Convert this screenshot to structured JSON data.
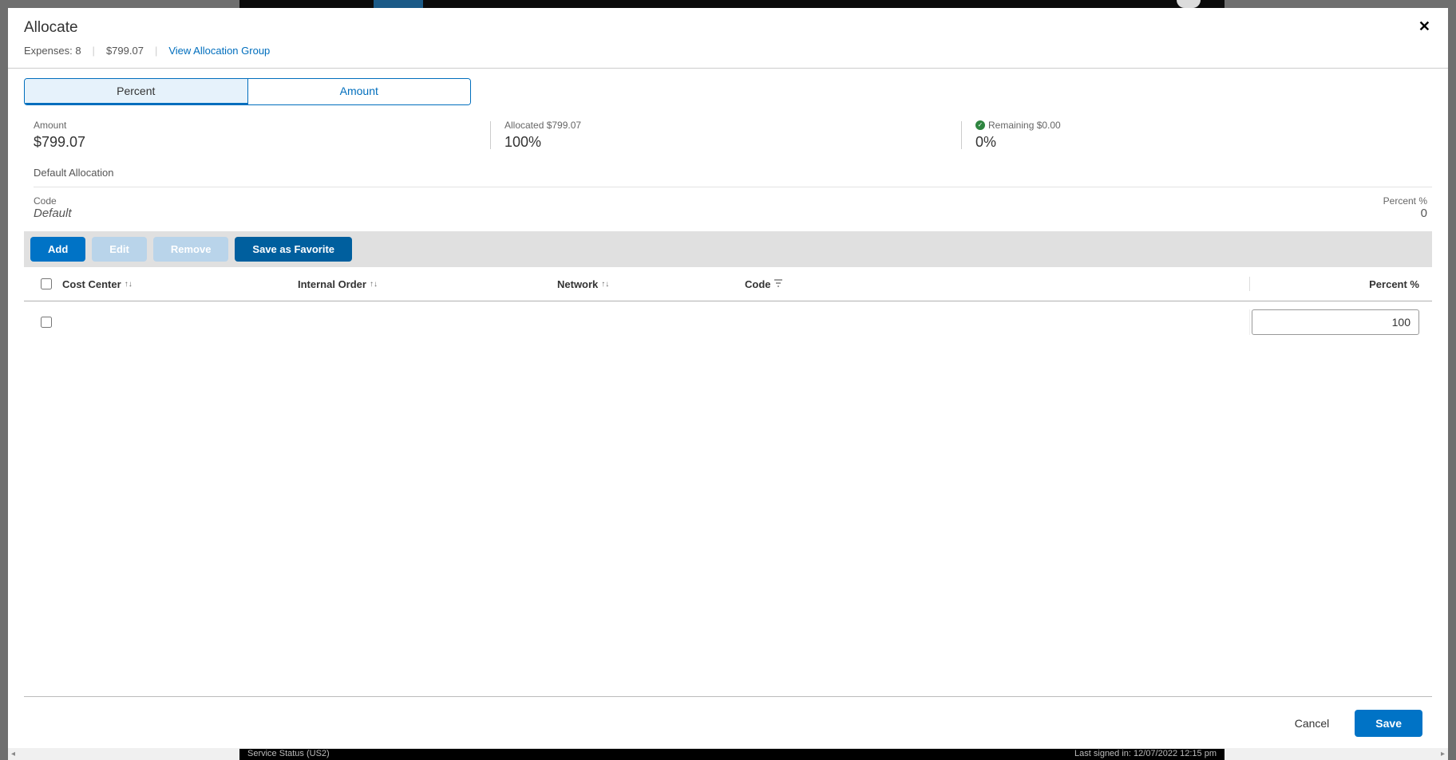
{
  "modal": {
    "title": "Allocate",
    "expenses_label": "Expenses: 8",
    "amount_text": "$799.07",
    "view_group_link": "View Allocation Group"
  },
  "tabs": {
    "percent": "Percent",
    "amount": "Amount"
  },
  "summary": {
    "amount": {
      "label": "Amount",
      "value": "$799.07"
    },
    "allocated": {
      "label": "Allocated $799.07",
      "value": "100%"
    },
    "remaining": {
      "label": "Remaining $0.00",
      "value": "0%"
    }
  },
  "default_alloc": {
    "title": "Default Allocation",
    "code_label": "Code",
    "code_value": "Default",
    "pct_label": "Percent %",
    "pct_value": "0"
  },
  "actions": {
    "add": "Add",
    "edit": "Edit",
    "remove": "Remove",
    "save_fav": "Save as Favorite"
  },
  "columns": {
    "cost_center": "Cost Center",
    "internal_order": "Internal Order",
    "network": "Network",
    "code": "Code",
    "percent": "Percent %"
  },
  "row": {
    "percent_value": "100"
  },
  "footer": {
    "cancel": "Cancel",
    "save": "Save"
  },
  "status": {
    "left": "Service Status (US2)",
    "right": "Last signed in: 12/07/2022 12:15 pm"
  },
  "scroll": {
    "left": "◂",
    "right": "▸"
  }
}
